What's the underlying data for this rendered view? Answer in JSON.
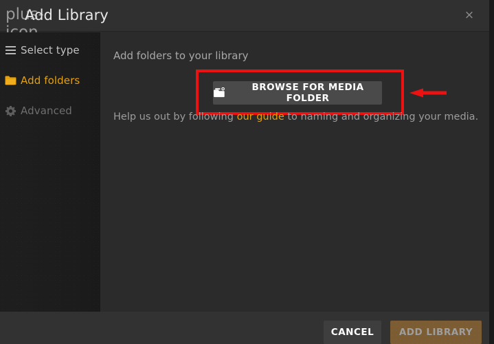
{
  "window": {
    "title": "Add Library",
    "plus_icon": "plus-icon",
    "close_icon": "×"
  },
  "sidebar": {
    "items": [
      {
        "label": "Select type",
        "icon": "list-icon",
        "state": "inactive"
      },
      {
        "label": "Add folders",
        "icon": "folder-icon",
        "state": "active"
      },
      {
        "label": "Advanced",
        "icon": "gear-icon",
        "state": "disabled"
      }
    ]
  },
  "main": {
    "heading": "Add folders to your library",
    "browse_button": {
      "label": "BROWSE FOR MEDIA FOLDER",
      "icon": "media-folder-icon"
    },
    "helper": {
      "prefix": "Help us out by following ",
      "link": "our guide",
      "suffix": " to naming and organizing your media."
    }
  },
  "footer": {
    "cancel_label": "CANCEL",
    "add_library_label": "ADD LIBRARY"
  },
  "annotations": {
    "highlight_box_color": "#ee1111",
    "arrow_color": "#ee1111",
    "arrow_direction": "left"
  },
  "colors": {
    "accent": "#e5a00d",
    "window_bg": "#2b2b2b",
    "sidebar_bg": "#1d1d1d",
    "titlebar_bg": "#303030",
    "footer_bg": "#323232",
    "button_bg": "#4a4a4a",
    "add_library_bg": "#7b5c33"
  }
}
